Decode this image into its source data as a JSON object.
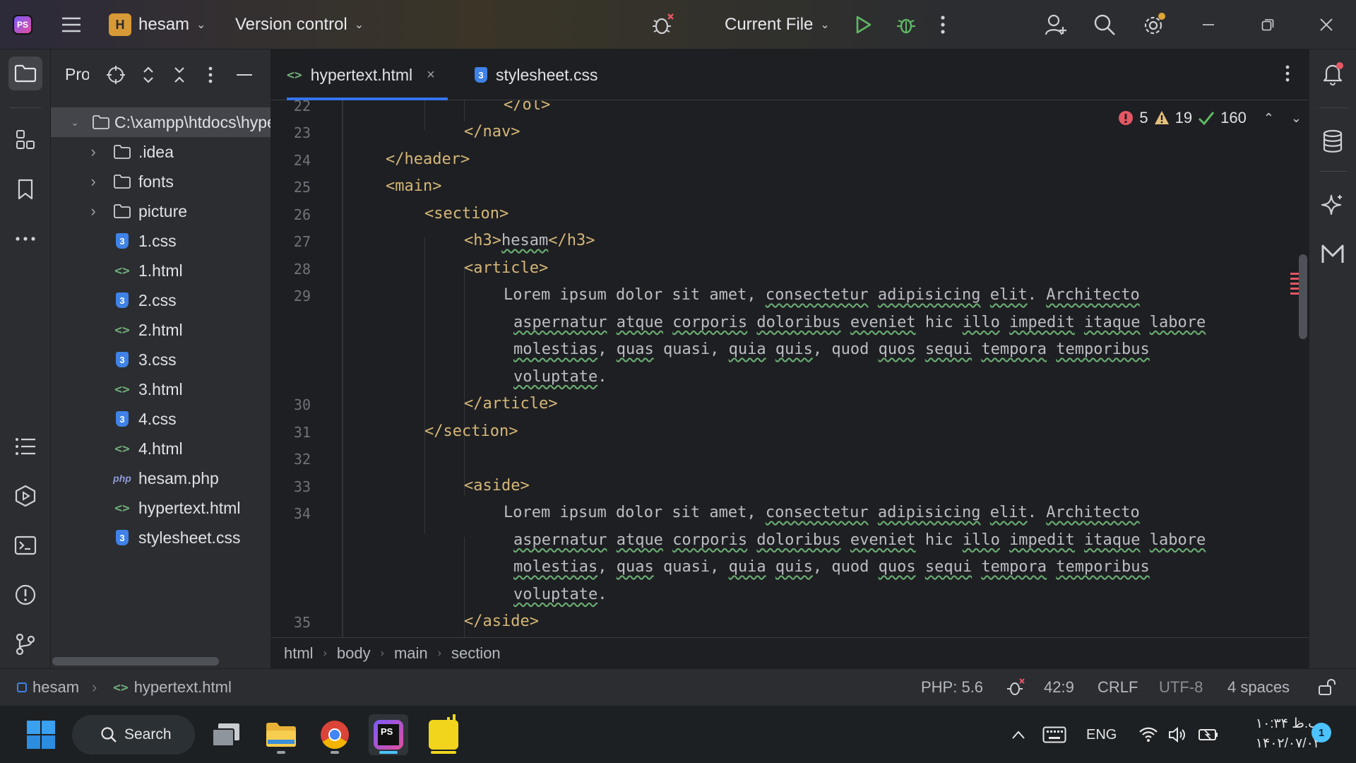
{
  "titlebar": {
    "project_badge": "H",
    "project_name": "hesam",
    "vcs_label": "Version control",
    "run_config": "Current File"
  },
  "project_panel": {
    "title": "Project",
    "root": "C:\\xampp\\htdocs\\hypertext",
    "items": [
      {
        "label": ".idea",
        "type": "folder"
      },
      {
        "label": "fonts",
        "type": "folder"
      },
      {
        "label": "picture",
        "type": "folder"
      },
      {
        "label": "1.css",
        "type": "css"
      },
      {
        "label": "1.html",
        "type": "html"
      },
      {
        "label": "2.css",
        "type": "css"
      },
      {
        "label": "2.html",
        "type": "html"
      },
      {
        "label": "3.css",
        "type": "css"
      },
      {
        "label": "3.html",
        "type": "html"
      },
      {
        "label": "4.css",
        "type": "css"
      },
      {
        "label": "4.html",
        "type": "html"
      },
      {
        "label": "hesam.php",
        "type": "php"
      },
      {
        "label": "hypertext.html",
        "type": "html"
      },
      {
        "label": "stylesheet.css",
        "type": "css"
      }
    ]
  },
  "tabs": [
    {
      "label": "hypertext.html",
      "active": true
    },
    {
      "label": "stylesheet.css",
      "active": false
    }
  ],
  "inspections": {
    "errors": "5",
    "warnings": "19",
    "ok": "160"
  },
  "line_numbers": [
    "22",
    "23",
    "24",
    "25",
    "26",
    "27",
    "28",
    "29",
    "30",
    "31",
    "32",
    "33",
    "34",
    "35"
  ],
  "code": {
    "l22": "</ol>",
    "l23": "</nav>",
    "l24": "</header>",
    "l25": "<main>",
    "l26": "<section>",
    "l27_open": "<h3>",
    "l27_text": "hesam",
    "l27_close": "</h3>",
    "l28": "<article>",
    "lorem": [
      [
        "Lorem ipsum dolor sit amet, ",
        {
          "w": "consectetur"
        },
        " ",
        {
          "w": "adipisicing"
        },
        " ",
        {
          "w": "elit"
        },
        ". ",
        {
          "w": "Architecto"
        }
      ],
      [
        {
          "w": "aspernatur"
        },
        " ",
        {
          "w": "atque"
        },
        " ",
        {
          "w": "corporis"
        },
        " ",
        {
          "w": "doloribus"
        },
        " ",
        {
          "w": "eveniet"
        },
        " hic ",
        {
          "w": "illo"
        },
        " ",
        {
          "w": "impedit"
        },
        " ",
        {
          "w": "itaque"
        },
        " ",
        {
          "w": "labore"
        }
      ],
      [
        {
          "w": "molestias"
        },
        ", ",
        {
          "w": "quas"
        },
        " quasi, ",
        {
          "w": "quia"
        },
        " ",
        {
          "w": "quis"
        },
        ", quod ",
        {
          "w": "quos"
        },
        " ",
        {
          "w": "sequi"
        },
        " ",
        {
          "w": "tempora"
        },
        " ",
        {
          "w": "temporibus"
        }
      ],
      [
        {
          "w": "voluptate"
        },
        "."
      ]
    ],
    "l30": "</article>",
    "l31": "</section>",
    "l33": "<aside>",
    "l35": "</aside>"
  },
  "breadcrumbs": [
    "html",
    "body",
    "main",
    "section"
  ],
  "statusbar": {
    "project": "hesam",
    "file": "hypertext.html",
    "php": "PHP: 5.6",
    "position": "42:9",
    "line_sep": "CRLF",
    "encoding": "UTF-8",
    "indent": "4 spaces"
  },
  "taskbar": {
    "search_label": "Search",
    "lang": "ENG",
    "time": "۱۰:۳۴ ب.ظ",
    "date": "۱۴۰۲/۰۷/۰۲",
    "notifications": "1"
  },
  "colors": {
    "accent": "#3574f0",
    "tag": "#d5b778",
    "error": "#e55765",
    "warning": "#e5c07b",
    "ok": "#5fb865"
  }
}
